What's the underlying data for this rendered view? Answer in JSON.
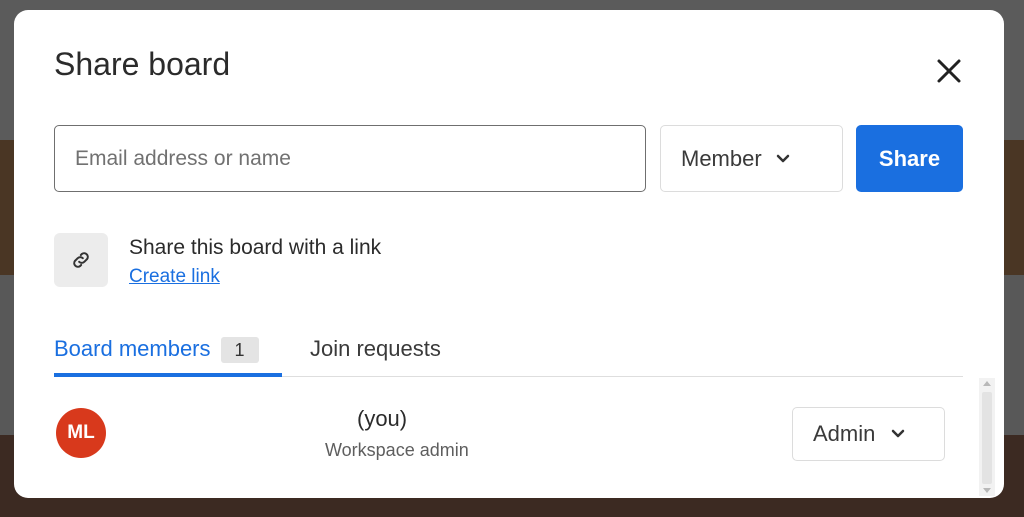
{
  "dialog": {
    "title": "Share board",
    "close_icon": "close-icon"
  },
  "invite": {
    "email_placeholder": "Email address or name",
    "email_value": "",
    "role_selected": "Member",
    "share_label": "Share"
  },
  "link_section": {
    "icon": "link-icon",
    "title": "Share this board with a link",
    "action_label": "Create link"
  },
  "tabs": [
    {
      "label": "Board members",
      "count": "1",
      "active": true
    },
    {
      "label": "Join requests",
      "active": false
    }
  ],
  "members": [
    {
      "initials": "ML",
      "name": "(you)",
      "subtitle": "Workspace admin",
      "role": "Admin",
      "avatar_color": "#d8391c"
    }
  ],
  "colors": {
    "accent": "#1a6fe0",
    "avatar": "#d8391c"
  }
}
